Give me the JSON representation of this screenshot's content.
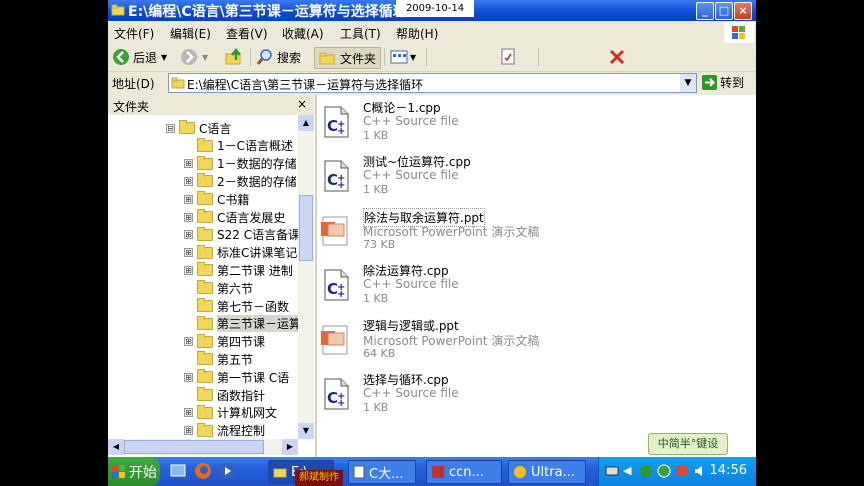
{
  "window": {
    "title": "E:\\编程\\C语言\\第三节课－运算符与选择循环",
    "date_overlay": "2009-10-14"
  },
  "window_buttons": {
    "minimize": "_",
    "maximize": "□",
    "close": "×"
  },
  "menu": [
    "文件(F)",
    "编辑(E)",
    "查看(V)",
    "收藏(A)",
    "工具(T)",
    "帮助(H)"
  ],
  "toolbar": {
    "back": "后退",
    "search": "搜索",
    "folders": "文件夹"
  },
  "address": {
    "label": "地址(D)",
    "path": "E:\\编程\\C语言\\第三节课－运算符与选择循环",
    "go": "转到"
  },
  "folders_pane": {
    "title": "文件夹",
    "close": "×",
    "items": [
      {
        "label": "C语言",
        "expander": "⊟",
        "depth": 0
      },
      {
        "label": "1－C语言概述",
        "expander": "",
        "depth": 1
      },
      {
        "label": "1－数据的存储",
        "expander": "⊞",
        "depth": 1
      },
      {
        "label": "2－数据的存储",
        "expander": "⊞",
        "depth": 1
      },
      {
        "label": "C书籍",
        "expander": "⊞",
        "depth": 1
      },
      {
        "label": "C语言发展史",
        "expander": "⊞",
        "depth": 1
      },
      {
        "label": "S22 C语言备课",
        "expander": "⊞",
        "depth": 1
      },
      {
        "label": "标准C讲课笔记",
        "expander": "⊞",
        "depth": 1
      },
      {
        "label": "第二节课 进制",
        "expander": "⊞",
        "depth": 1
      },
      {
        "label": "第六节",
        "expander": "",
        "depth": 1
      },
      {
        "label": "第七节－函数",
        "expander": "",
        "depth": 1
      },
      {
        "label": "第三节课－运算",
        "expander": "",
        "depth": 1,
        "selected": true
      },
      {
        "label": "第四节课",
        "expander": "⊞",
        "depth": 1
      },
      {
        "label": "第五节",
        "expander": "",
        "depth": 1
      },
      {
        "label": "第一节课 C语",
        "expander": "⊞",
        "depth": 1
      },
      {
        "label": "函数指针",
        "expander": "",
        "depth": 1
      },
      {
        "label": "计算机网文",
        "expander": "⊞",
        "depth": 1
      },
      {
        "label": "流程控制",
        "expander": "⊞",
        "depth": 1
      }
    ]
  },
  "files": [
    {
      "name": "C概论－1.cpp",
      "type": "C++ Source file",
      "size": "1 KB",
      "icon": "cpp-file-icon"
    },
    {
      "name": "测试~位运算符.cpp",
      "type": "C++ Source file",
      "size": "1 KB",
      "icon": "cpp-file-icon"
    },
    {
      "name": "除法与取余运算符.ppt",
      "type": "Microsoft PowerPoint 演示文稿",
      "size": "73 KB",
      "icon": "ppt-file-icon",
      "selected": true
    },
    {
      "name": "除法运算符.cpp",
      "type": "C++ Source file",
      "size": "1 KB",
      "icon": "cpp-file-icon"
    },
    {
      "name": "逻辑与逻辑或.ppt",
      "type": "Microsoft PowerPoint 演示文稿",
      "size": "64 KB",
      "icon": "ppt-file-icon"
    },
    {
      "name": "选择与循环.cpp",
      "type": "C++ Source file",
      "size": "1 KB",
      "icon": "cpp-file-icon"
    }
  ],
  "ime_label": "中简半°键设",
  "taskbar": {
    "start": "开始",
    "tasks": [
      {
        "label": "E:\\...",
        "active": true
      },
      {
        "label": "C大..."
      },
      {
        "label": "ccn..."
      },
      {
        "label": "Ultra..."
      }
    ],
    "clock": "14:56"
  },
  "watermark": "郝斌制作",
  "colors": {
    "titlebar": "#0a4ad6",
    "taskbar": "#245edb",
    "start": "#2b8a2b",
    "folder": "#f2d65a"
  }
}
